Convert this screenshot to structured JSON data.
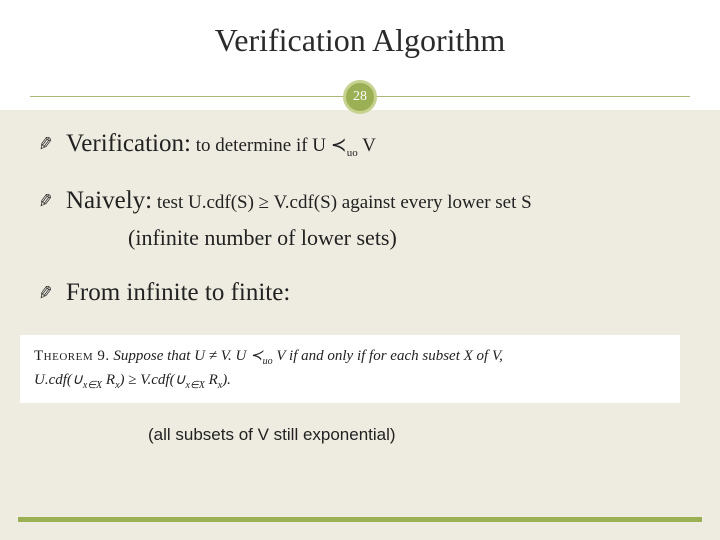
{
  "slide": {
    "title": "Verification Algorithm",
    "page_number": "28",
    "bullets": {
      "verification": {
        "lead": "Verification:",
        "rest_pre": " to determine if U ",
        "op": "≺",
        "sub": "uo",
        "rest_post": " V"
      },
      "naively": {
        "lead": "Naively:",
        "rest": " test U.cdf(S) ≥ V.cdf(S) against every lower set S",
        "aside": "(infinite number of lower sets)"
      },
      "finite": {
        "lead": "From infinite to finite:"
      }
    },
    "theorem": {
      "label": "Theorem 9.",
      "body_pre": " Suppose that U ≠ V. U ",
      "op": "≺",
      "sub": "uo",
      "body_mid": " V if and only if for each subset X of V,",
      "line2_pre": "U.cdf(∪",
      "line2_sub1": "x∈X",
      "line2_mid1": " R",
      "line2_sub2": "x",
      "line2_mid2": ") ≥ V.cdf(∪",
      "line2_sub3": "x∈X",
      "line2_mid3": " R",
      "line2_sub4": "x",
      "line2_post": ")."
    },
    "note": "(all subsets of V still exponential)"
  }
}
